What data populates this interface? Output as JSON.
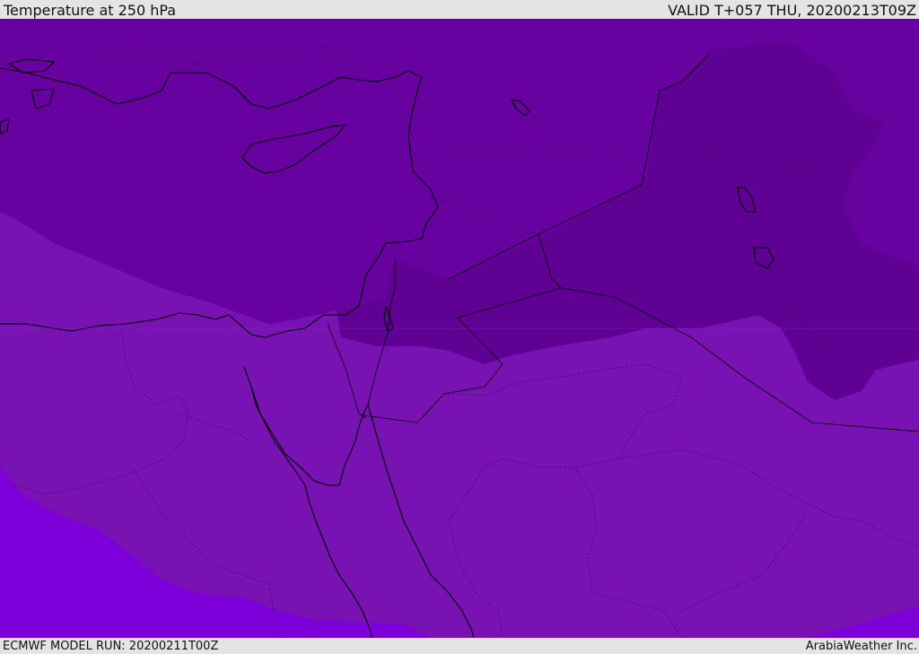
{
  "header": {
    "title": "Temperature at 250 hPa",
    "valid_time": "VALID T+057 THU, 20200213T09Z"
  },
  "footer": {
    "model_run": "ECMWF MODEL RUN: 20200211T00Z",
    "credit": "ArabiaWeather Inc."
  },
  "map": {
    "colors": {
      "band_coldest": "#5f0193",
      "band_cold": "#6701a0",
      "band_mid": "#7812b2",
      "band_warm": "#7d00da",
      "coastline": "#000000",
      "border": "#000000"
    }
  }
}
